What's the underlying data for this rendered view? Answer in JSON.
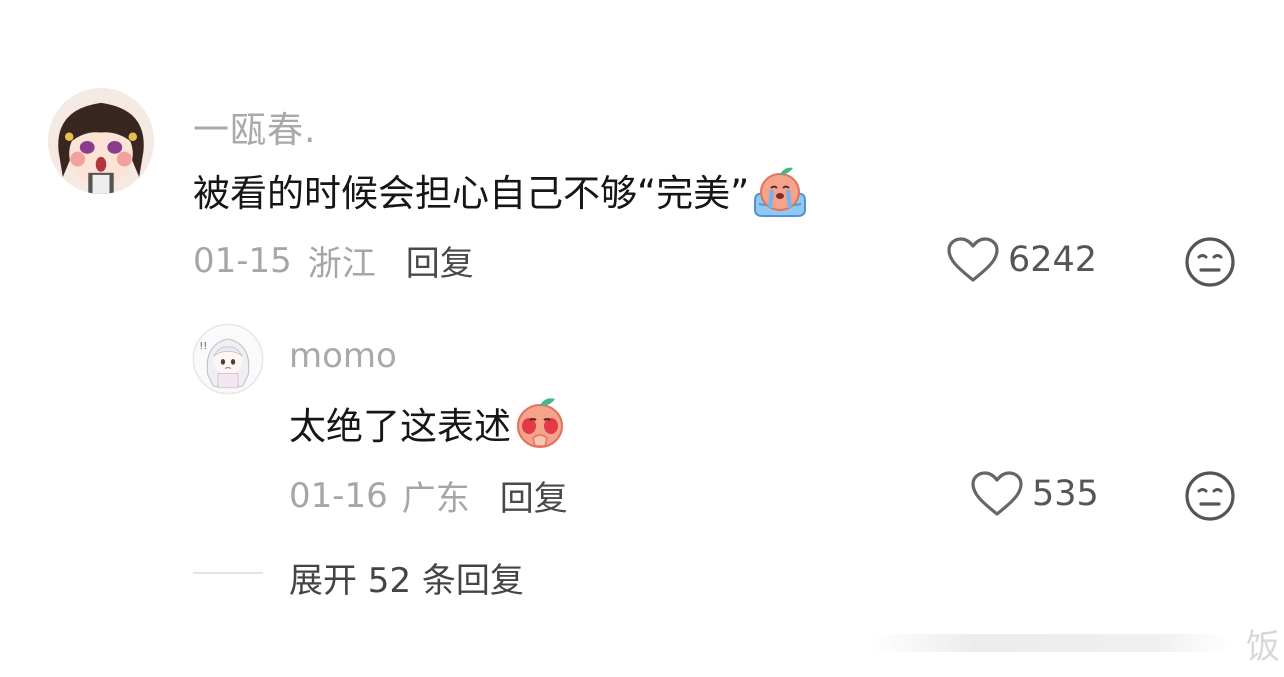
{
  "comments": [
    {
      "username": "一瓯春.",
      "text": "被看的时候会担心自己不够“完美”",
      "sticker": "crying-peach-sticker",
      "date": "01-15",
      "location": "浙江",
      "reply_label": "回复",
      "likes": "6242",
      "replies": [
        {
          "username": "momo",
          "text": "太绝了这表述",
          "sticker": "blushing-peach-sticker",
          "date": "01-16",
          "location": "广东",
          "reply_label": "回复",
          "likes": "535"
        }
      ]
    }
  ],
  "expand_label": "展开 52 条回复",
  "watermark": "饭",
  "colors": {
    "username": "#a9a9a9",
    "meta": "#a6a6a6",
    "text": "#161616",
    "sticker_peach": "#f6a38c"
  }
}
